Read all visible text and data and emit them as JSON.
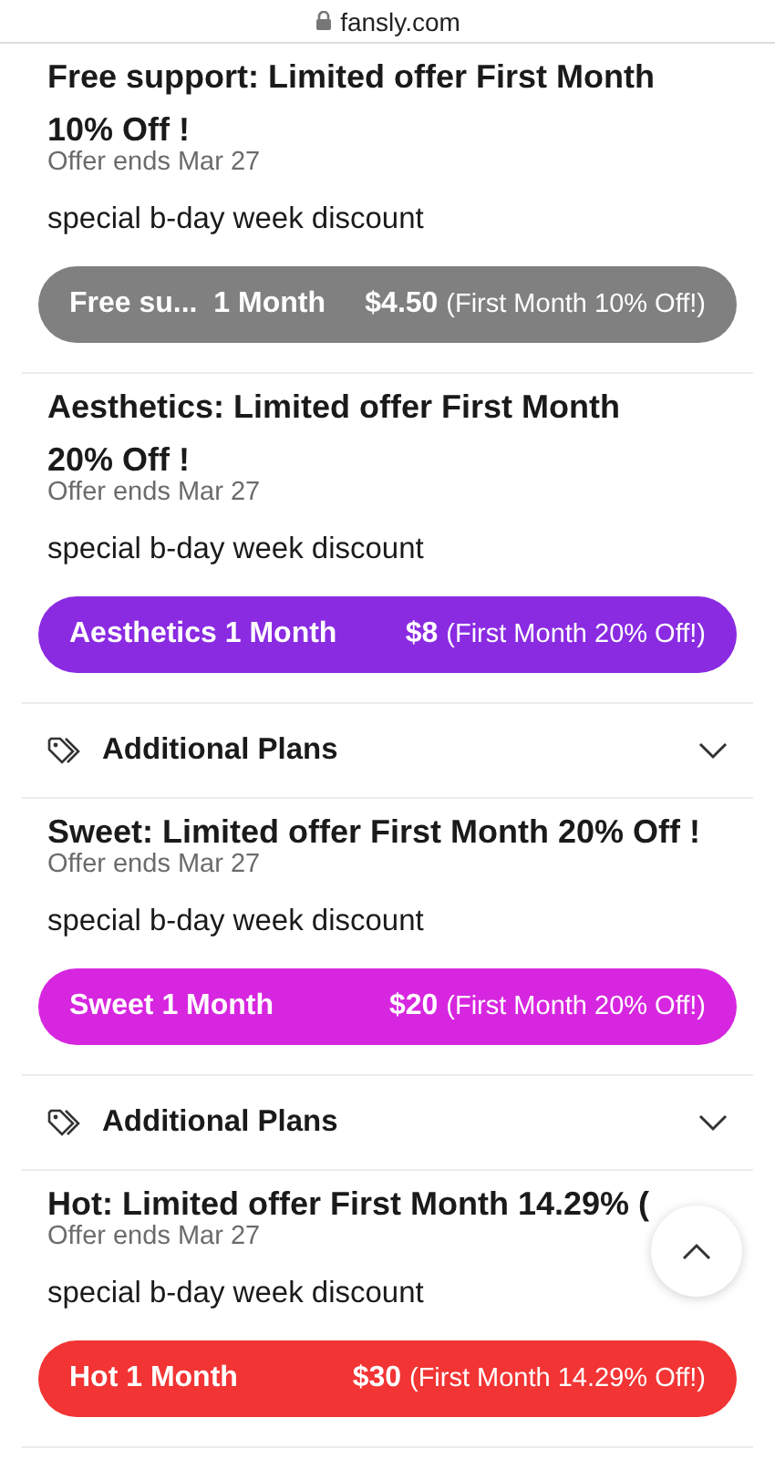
{
  "address_bar": {
    "url": "fansly.com"
  },
  "items": [
    {
      "kind": "offer",
      "title": "Free support: Limited offer First Month\n10% Off !",
      "ends": "Offer ends Mar 27",
      "description": "special b-day week discount",
      "button": {
        "name": "Free su...  1 Month",
        "price": "$4.50",
        "note": "(First Month 10% Off!)",
        "color": "#808080"
      }
    },
    {
      "kind": "offer",
      "title": "Aesthetics: Limited offer First Month\n20% Off !",
      "ends": "Offer ends Mar 27",
      "description": "special b-day week discount",
      "button": {
        "name": "Aesthetics 1 Month",
        "price": "$8",
        "note": "(First Month 20% Off!)",
        "color": "#8a2be2"
      }
    },
    {
      "kind": "plans",
      "label": "Additional Plans",
      "expanded": false
    },
    {
      "kind": "offer",
      "title": "Sweet: Limited offer First Month 20% Off !",
      "ends": "Offer ends Mar 27",
      "description": "special b-day week discount",
      "button": {
        "name": "Sweet 1 Month",
        "price": "$20",
        "note": "(First Month 20% Off!)",
        "color": "#d726e0"
      }
    },
    {
      "kind": "plans",
      "label": "Additional Plans",
      "expanded": false
    },
    {
      "kind": "offer",
      "title": "Hot: Limited offer First Month 14.29% (",
      "ends": "Offer ends Mar 27",
      "description": "special b-day week discount",
      "button": {
        "name": "Hot 1 Month",
        "price": "$30",
        "note": "(First Month 14.29% Off!)",
        "color": "#f23434"
      }
    }
  ]
}
